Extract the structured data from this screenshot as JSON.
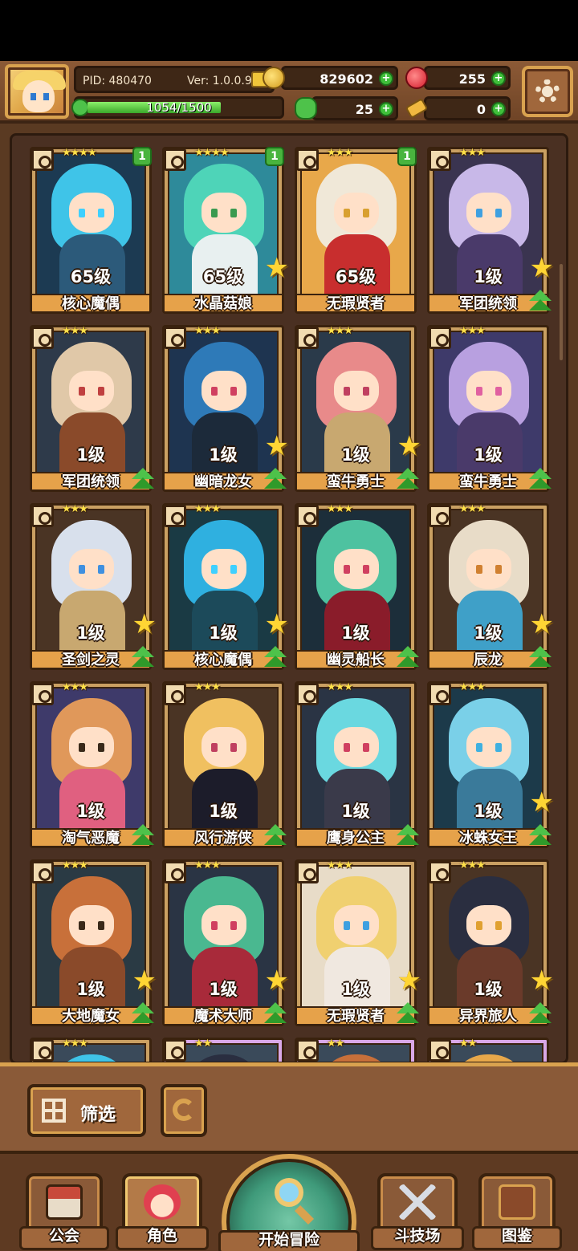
{
  "header": {
    "pid": "PID: 480470",
    "version": "Ver: 1.0.0.9",
    "gold": "829602",
    "ruby": "255",
    "clover": "25",
    "keys": "0",
    "exp_text": "1054/1500",
    "exp_fraction": 0.703
  },
  "heroes": [
    {
      "name": "核心魔偶",
      "level": "65级",
      "stars": "★★★★",
      "badge": "1",
      "hair": "#3fc4e8",
      "body": "#2c5a7a",
      "bg": "#1c3a52",
      "eye": "#3fd0ff",
      "star_icon": false,
      "up": false
    },
    {
      "name": "水晶菇娘",
      "level": "65级",
      "stars": "★★★★",
      "badge": "1",
      "hair": "#4ed4b8",
      "body": "#e8f0f0",
      "bg": "#2e8a9a",
      "eye": "#3a9a50",
      "star_icon": true,
      "up": false
    },
    {
      "name": "无瑕贤者",
      "level": "65级",
      "stars": "★★★",
      "badge": "1",
      "hair": "#f0e8d8",
      "body": "#c82e2e",
      "bg": "#e8a84a",
      "eye": "#d8a030",
      "star_icon": false,
      "up": false
    },
    {
      "name": "军团统领",
      "level": "1级",
      "stars": "★★★",
      "badge": "",
      "hair": "#c8b8e8",
      "body": "#4a3a6a",
      "bg": "#3a3450",
      "eye": "#3fa0e0",
      "star_icon": true,
      "up": true
    },
    {
      "name": "军团统领",
      "level": "1级",
      "stars": "★★★",
      "badge": "",
      "hair": "#e0c8a8",
      "body": "#8a4a2a",
      "bg": "#2e3a4a",
      "eye": "#c04040",
      "star_icon": false,
      "up": true
    },
    {
      "name": "幽暗龙女",
      "level": "1级",
      "stars": "★★★",
      "badge": "",
      "hair": "#2e7ab8",
      "body": "#1c2a3a",
      "bg": "#1e3450",
      "eye": "#d04060",
      "star_icon": true,
      "up": true
    },
    {
      "name": "蛮牛勇士",
      "level": "1级",
      "stars": "★★★",
      "badge": "",
      "hair": "#e88a8a",
      "body": "#c8a870",
      "bg": "#2a3a4a",
      "eye": "#c04060",
      "star_icon": true,
      "up": true
    },
    {
      "name": "蛮牛勇士",
      "level": "1级",
      "stars": "★★★",
      "badge": "",
      "hair": "#b8a0e0",
      "body": "#4a3a6a",
      "bg": "#3e3a6a",
      "eye": "#e060a0",
      "star_icon": false,
      "up": true
    },
    {
      "name": "圣剑之灵",
      "level": "1级",
      "stars": "★★★",
      "badge": "",
      "hair": "#d8e0ec",
      "body": "#c8a870",
      "bg": "#4a3424",
      "eye": "#3f90e0",
      "star_icon": true,
      "up": true
    },
    {
      "name": "核心魔偶",
      "level": "1级",
      "stars": "★★★",
      "badge": "",
      "hair": "#2fb0e0",
      "body": "#1c4a5a",
      "bg": "#1a3a44",
      "eye": "#3fd0ff",
      "star_icon": true,
      "up": true
    },
    {
      "name": "幽灵船长",
      "level": "1级",
      "stars": "★★★",
      "badge": "",
      "hair": "#4ec2a0",
      "body": "#8a1c2a",
      "bg": "#1c2e3a",
      "eye": "#d04060",
      "star_icon": false,
      "up": true
    },
    {
      "name": "辰龙",
      "level": "1级",
      "stars": "★★★",
      "badge": "",
      "hair": "#e8dcc8",
      "body": "#3fa0c8",
      "bg": "#4a3424",
      "eye": "#d08030",
      "star_icon": true,
      "up": true
    },
    {
      "name": "淘气恶魔",
      "level": "1级",
      "stars": "★★★",
      "badge": "",
      "hair": "#e0985a",
      "body": "#e06080",
      "bg": "#3e3a6a",
      "eye": "#3a2a1a",
      "star_icon": false,
      "up": true
    },
    {
      "name": "风行游侠",
      "level": "1级",
      "stars": "★★★",
      "badge": "",
      "hair": "#f0c060",
      "body": "#1c1c2a",
      "bg": "#4a3424",
      "eye": "#c04060",
      "star_icon": false,
      "up": true
    },
    {
      "name": "鹰身公主",
      "level": "1级",
      "stars": "★★★",
      "badge": "",
      "hair": "#6ad8e0",
      "body": "#3a3a4a",
      "bg": "#2a3444",
      "eye": "#d04060",
      "star_icon": false,
      "up": true
    },
    {
      "name": "冰蛛女王",
      "level": "1级",
      "stars": "★★★",
      "badge": "",
      "hair": "#7ad0e8",
      "body": "#3a7a9a",
      "bg": "#1c3a4a",
      "eye": "#3fb0e0",
      "star_icon": true,
      "up": true
    },
    {
      "name": "大地魔女",
      "level": "1级",
      "stars": "★★★",
      "badge": "",
      "hair": "#c8703a",
      "body": "#8a4a2a",
      "bg": "#2a3a44",
      "eye": "#3a2a1a",
      "star_icon": true,
      "up": true
    },
    {
      "name": "魔术大师",
      "level": "1级",
      "stars": "★★★",
      "badge": "",
      "hair": "#4ab890",
      "body": "#a82a3a",
      "bg": "#2a3444",
      "eye": "#d04060",
      "star_icon": true,
      "up": true
    },
    {
      "name": "无瑕贤者",
      "level": "1级",
      "stars": "★★★",
      "badge": "",
      "hair": "#f0d070",
      "body": "#f0e8e0",
      "bg": "#e8dcc8",
      "eye": "#3fa0e0",
      "star_icon": true,
      "up": true
    },
    {
      "name": "异界旅人",
      "level": "1级",
      "stars": "★★★",
      "badge": "",
      "hair": "#2a2e40",
      "body": "#6a3a2a",
      "bg": "#4a3424",
      "eye": "#e0a030",
      "star_icon": true,
      "up": true
    }
  ],
  "partial_row": [
    {
      "stars": "★★★",
      "pink": false,
      "hair": "#3fc4e8"
    },
    {
      "stars": "★★",
      "pink": true,
      "hair": "#2a2e40"
    },
    {
      "stars": "★★",
      "pink": true,
      "hair": "#c8703a"
    },
    {
      "stars": "★★",
      "pink": true,
      "hair": "#e8a84a"
    }
  ],
  "filter": {
    "label": "筛选"
  },
  "nav": {
    "guild": "公会",
    "character": "角色",
    "adventure": "开始冒险",
    "arena": "斗技场",
    "codex": "图鉴"
  }
}
